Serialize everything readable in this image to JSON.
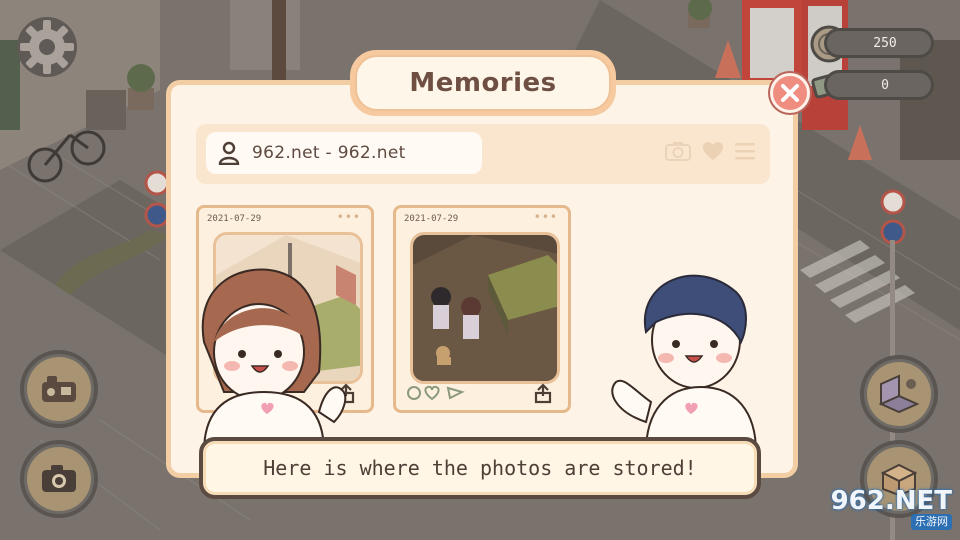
{
  "hud": {
    "coins": "250",
    "cash": "0"
  },
  "dialog": {
    "title": "Memories",
    "profile_name": "962.net - 962.net",
    "photos": [
      {
        "date": "2021-07-29",
        "dots": "•••"
      },
      {
        "date": "2021-07-29",
        "dots": "•••"
      }
    ]
  },
  "speech": {
    "text": "Here is where the photos are stored!"
  },
  "watermark": {
    "main": "962.NET",
    "sub": "乐游网"
  },
  "colors": {
    "dialog_bg": "#fdf3e6",
    "dialog_border": "#f3cda3",
    "close_btn": "#ef8e80",
    "title_text": "#6e4f41"
  }
}
